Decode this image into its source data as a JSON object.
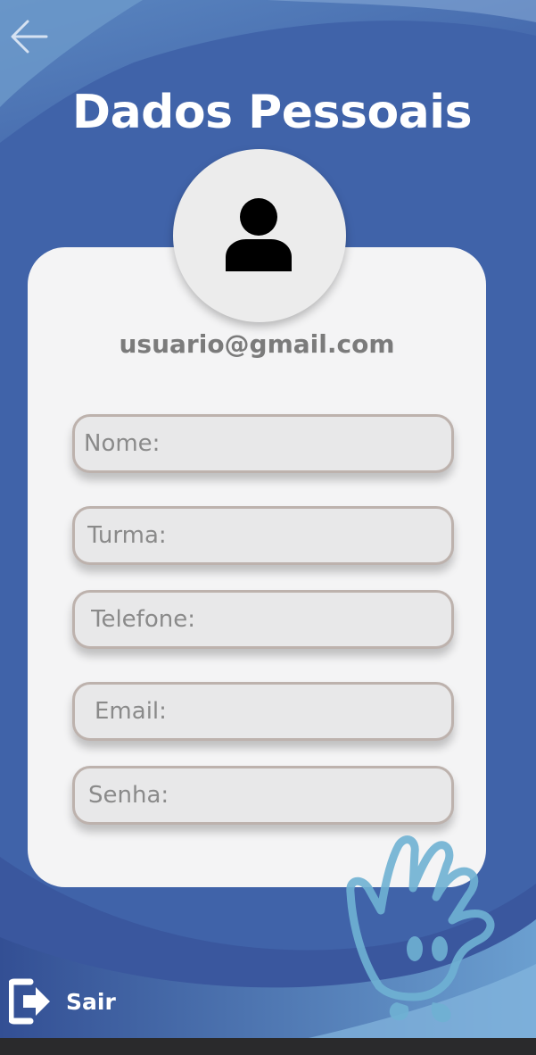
{
  "header": {
    "title": "Dados Pessoais",
    "back_icon": "arrow-left-icon"
  },
  "profile": {
    "avatar_icon": "user-icon",
    "email": "usuario@gmail.com"
  },
  "form": {
    "fields": [
      {
        "name": "nome",
        "placeholder": "Nome:"
      },
      {
        "name": "turma",
        "placeholder": "Turma:"
      },
      {
        "name": "telefone",
        "placeholder": "Telefone:"
      },
      {
        "name": "email",
        "placeholder": "Email:"
      },
      {
        "name": "senha",
        "placeholder": "Senha:"
      }
    ]
  },
  "footer": {
    "logout_label": "Sair",
    "logout_icon": "logout-icon"
  },
  "colors": {
    "background": "#3f5fa6",
    "card": "#f4f4f5",
    "field_border": "#bdb2ad",
    "mascot": "#6fb1d3"
  }
}
